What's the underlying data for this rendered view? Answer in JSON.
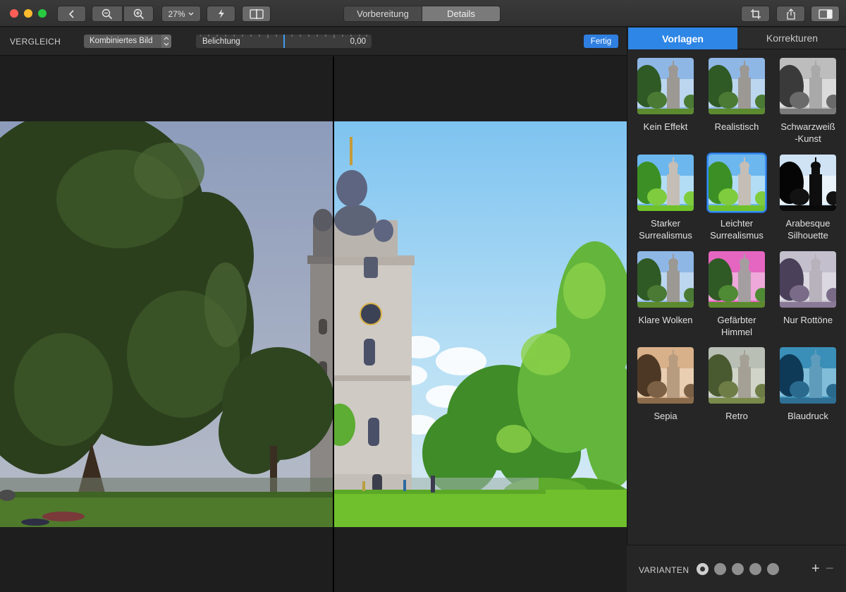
{
  "toolbar": {
    "zoom_label": "27%",
    "tab_prep": "Vorbereitung",
    "tab_details": "Details"
  },
  "compare": {
    "label": "VERGLEICH",
    "mode": "Kombiniertes Bild",
    "slider_label": "Belichtung",
    "slider_value": "0,00",
    "done": "Fertig"
  },
  "panel": {
    "tab_presets": "Vorlagen",
    "tab_corrections": "Korrekturen",
    "presets": [
      {
        "name": "Kein Effekt",
        "style": "normal"
      },
      {
        "name": "Realistisch",
        "style": "normal"
      },
      {
        "name": "Schwarzweiß\n-Kunst",
        "style": "bw"
      },
      {
        "name": "Starker\nSurrealismus",
        "style": "vivid"
      },
      {
        "name": "Leichter\nSurrealismus",
        "style": "vivid",
        "selected": true
      },
      {
        "name": "Arabesque\nSilhouette",
        "style": "silhouette"
      },
      {
        "name": "Klare Wolken",
        "style": "normal"
      },
      {
        "name": "Gefärbter\nHimmel",
        "style": "pink"
      },
      {
        "name": "Nur Rottöne",
        "style": "purple"
      },
      {
        "name": "Sepia",
        "style": "sepia"
      },
      {
        "name": "Retro",
        "style": "retro"
      },
      {
        "name": "Blaudruck",
        "style": "blue"
      }
    ]
  },
  "variants": {
    "label": "VARIANTEN",
    "count": 5,
    "active_index": 0,
    "add": "+",
    "remove": "−"
  }
}
